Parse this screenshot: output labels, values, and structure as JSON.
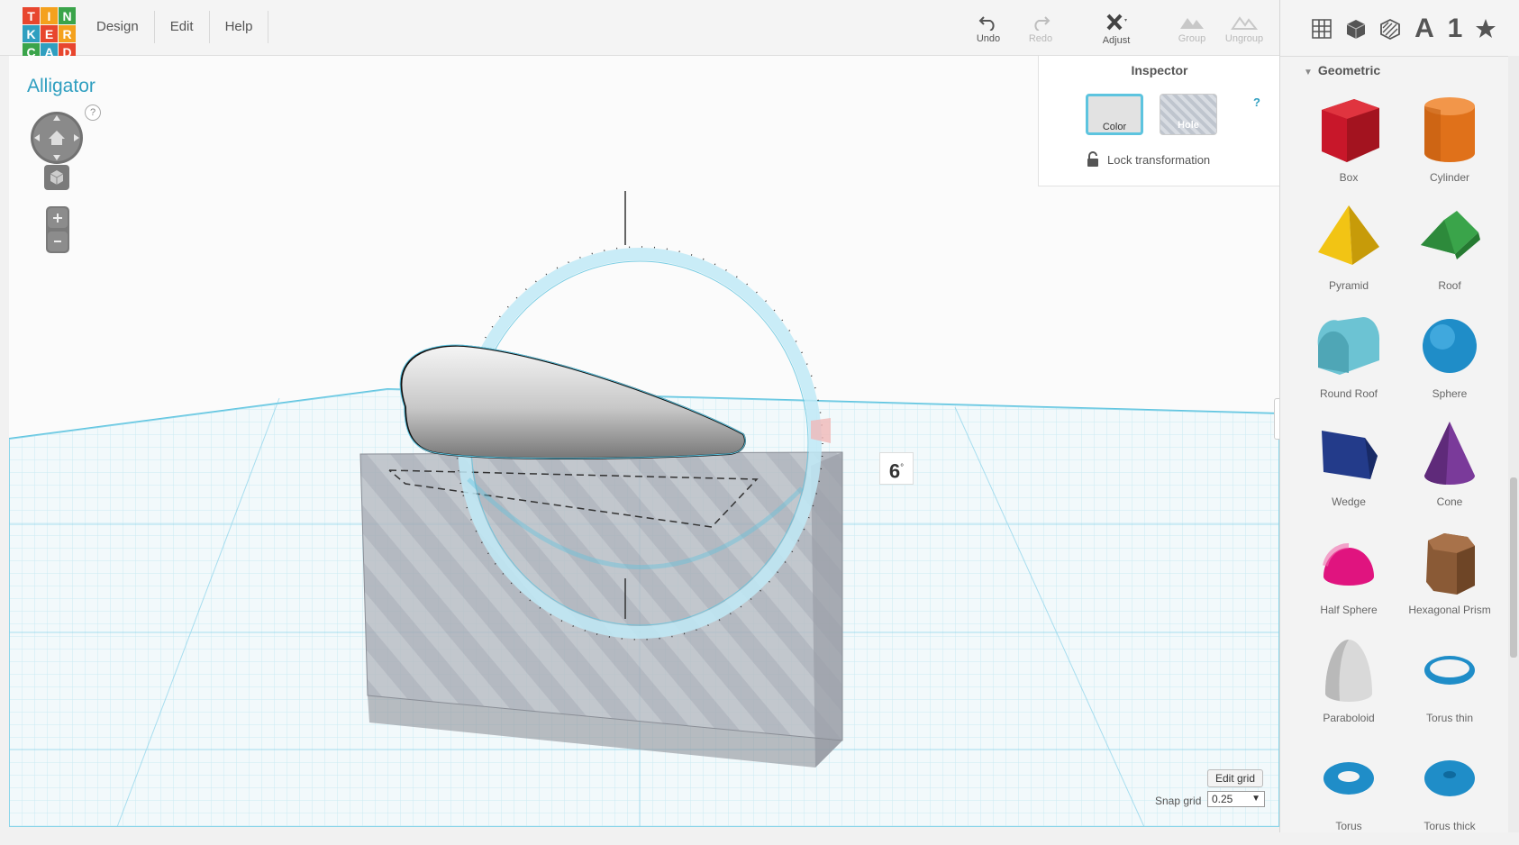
{
  "logo": {
    "letters": [
      "T",
      "I",
      "N",
      "K",
      "E",
      "R",
      "C",
      "A",
      "D"
    ],
    "colors": [
      "#e8462e",
      "#f4a11d",
      "#3aa44a",
      "#2f9fc0",
      "#e8462e",
      "#f4a11d",
      "#3aa44a",
      "#2f9fc0",
      "#e8462e"
    ]
  },
  "menu": {
    "design": "Design",
    "edit": "Edit",
    "help": "Help"
  },
  "toolbar": {
    "undo": "Undo",
    "redo": "Redo",
    "adjust": "Adjust",
    "group": "Group",
    "ungroup": "Ungroup"
  },
  "design_title": "Alligator",
  "view_help": "?",
  "inspector": {
    "title": "Inspector",
    "color_label": "Color",
    "hole_label": "Hole",
    "lock_label": "Lock transformation",
    "help": "?"
  },
  "rotation": {
    "value": "6",
    "unit": "°"
  },
  "grid": {
    "edit_label": "Edit grid",
    "snap_label": "Snap grid",
    "snap_value": "0.25"
  },
  "panel": {
    "text_tool": "A",
    "number_tool": "1",
    "category": "Geometric",
    "shapes": [
      {
        "label": "Box",
        "icon": "box-shape-icon",
        "color": "#c8172a"
      },
      {
        "label": "Cylinder",
        "icon": "cylinder-shape-icon",
        "color": "#e0711a"
      },
      {
        "label": "Pyramid",
        "icon": "pyramid-shape-icon",
        "color": "#f2c414"
      },
      {
        "label": "Roof",
        "icon": "roof-shape-icon",
        "color": "#3aa44a"
      },
      {
        "label": "Round Roof",
        "icon": "round-roof-shape-icon",
        "color": "#6cc3d3"
      },
      {
        "label": "Sphere",
        "icon": "sphere-shape-icon",
        "color": "#1f8dc8"
      },
      {
        "label": "Wedge",
        "icon": "wedge-shape-icon",
        "color": "#233b8a"
      },
      {
        "label": "Cone",
        "icon": "cone-shape-icon",
        "color": "#7a3a9a"
      },
      {
        "label": "Half Sphere",
        "icon": "half-sphere-shape-icon",
        "color": "#e0147f"
      },
      {
        "label": "Hexagonal Prism",
        "icon": "hexagonal-prism-shape-icon",
        "color": "#8a5a36"
      },
      {
        "label": "Paraboloid",
        "icon": "paraboloid-shape-icon",
        "color": "#d9d9d9"
      },
      {
        "label": "Torus thin",
        "icon": "torus-thin-shape-icon",
        "color": "#1f8dc8"
      },
      {
        "label": "Torus",
        "icon": "torus-shape-icon",
        "color": "#1f8dc8"
      },
      {
        "label": "Torus thick",
        "icon": "torus-thick-shape-icon",
        "color": "#1f8dc8"
      }
    ]
  }
}
